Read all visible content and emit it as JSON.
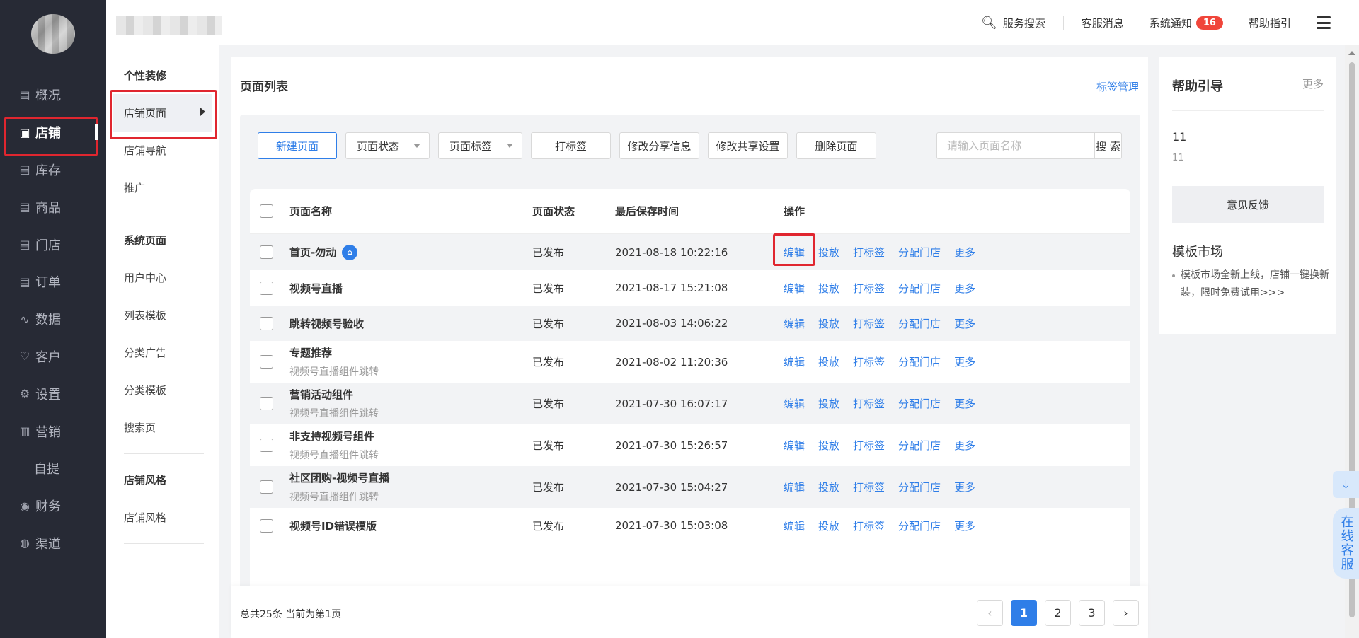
{
  "sidebar": {
    "items": [
      {
        "label": "概况",
        "icon": "overview-icon",
        "glyph": "▤"
      },
      {
        "label": "店铺",
        "icon": "store-icon",
        "glyph": "▣"
      },
      {
        "label": "库存",
        "icon": "inventory-icon",
        "glyph": "▤"
      },
      {
        "label": "商品",
        "icon": "goods-icon",
        "glyph": "▤"
      },
      {
        "label": "门店",
        "icon": "shop-icon",
        "glyph": "▤"
      },
      {
        "label": "订单",
        "icon": "order-icon",
        "glyph": "▤"
      },
      {
        "label": "数据",
        "icon": "data-icon",
        "glyph": "∿"
      },
      {
        "label": "客户",
        "icon": "customer-icon",
        "glyph": "♡"
      },
      {
        "label": "设置",
        "icon": "settings-icon",
        "glyph": "⚙"
      },
      {
        "label": "营销",
        "icon": "marketing-icon",
        "glyph": "▥"
      },
      {
        "label": "自提",
        "icon": "",
        "glyph": ""
      },
      {
        "label": "财务",
        "icon": "finance-icon",
        "glyph": "◉"
      },
      {
        "label": "渠道",
        "icon": "channel-icon",
        "glyph": "◍"
      }
    ]
  },
  "subnav": {
    "group1": "个性装修",
    "store_page": "店铺页面",
    "store_nav": "店铺导航",
    "promotion": "推广",
    "group2": "系统页面",
    "user_center": "用户中心",
    "list_template": "列表模板",
    "category_ad": "分类广告",
    "category_template": "分类模板",
    "search_page": "搜索页",
    "group3": "店铺风格",
    "store_style": "店铺风格"
  },
  "topbar": {
    "service_search": "服务搜索",
    "customer_msg": "客服消息",
    "system_notice": "系统通知",
    "notice_count": "16",
    "help_guide": "帮助指引"
  },
  "main": {
    "title": "页面列表",
    "tag_manage": "标签管理",
    "toolbar": {
      "new_page": "新建页面",
      "page_status": "页面状态",
      "page_tag": "页面标签",
      "tag_action": "打标签",
      "edit_share": "修改分享信息",
      "edit_co_share": "修改共享设置",
      "delete_page": "删除页面",
      "search_placeholder": "请输入页面名称",
      "search_btn": "搜 索"
    },
    "table": {
      "headers": {
        "name": "页面名称",
        "status": "页面状态",
        "time": "最后保存时间",
        "ops": "操作"
      },
      "ops": {
        "edit": "编辑",
        "launch": "投放",
        "tag": "打标签",
        "assign": "分配门店",
        "more": "更多"
      },
      "rows": [
        {
          "name": "首页-勿动",
          "sub": "",
          "status": "已发布",
          "time": "2021-08-18 10:22:16",
          "home": true
        },
        {
          "name": "视频号直播",
          "sub": "",
          "status": "已发布",
          "time": "2021-08-17 15:21:08",
          "home": false
        },
        {
          "name": "跳转视频号验收",
          "sub": "",
          "status": "已发布",
          "time": "2021-08-03 14:06:22",
          "home": false
        },
        {
          "name": "专题推荐",
          "sub": "视频号直播组件跳转",
          "status": "已发布",
          "time": "2021-08-02 11:20:36",
          "home": false
        },
        {
          "name": "营销活动组件",
          "sub": "视频号直播组件跳转",
          "status": "已发布",
          "time": "2021-07-30 16:07:17",
          "home": false
        },
        {
          "name": "非支持视频号组件",
          "sub": "视频号直播组件跳转",
          "status": "已发布",
          "time": "2021-07-30 15:26:57",
          "home": false
        },
        {
          "name": "社区团购-视频号直播",
          "sub": "视频号直播组件跳转",
          "status": "已发布",
          "time": "2021-07-30 15:04:27",
          "home": false
        },
        {
          "name": "视频号ID错误模版",
          "sub": "",
          "status": "已发布",
          "time": "2021-07-30 15:03:08",
          "home": false
        }
      ]
    },
    "pager": {
      "total_text": "总共25条 当前为第1页",
      "pages": [
        "1",
        "2",
        "3"
      ],
      "current": "1"
    }
  },
  "help": {
    "title": "帮助引导",
    "more": "更多",
    "n1": "11",
    "n2": "11",
    "feedback": "意见反馈",
    "tpl_title": "模板市场",
    "tpl_desc": "模板市场全新上线，店铺一键换新装，限时免费试用>>>"
  },
  "float": {
    "customer_service": "在线客服"
  },
  "colors": {
    "accent": "#2f7ee8",
    "sidebar_bg": "#272a35",
    "highlight": "#e0262f",
    "badge": "#f0453a"
  }
}
